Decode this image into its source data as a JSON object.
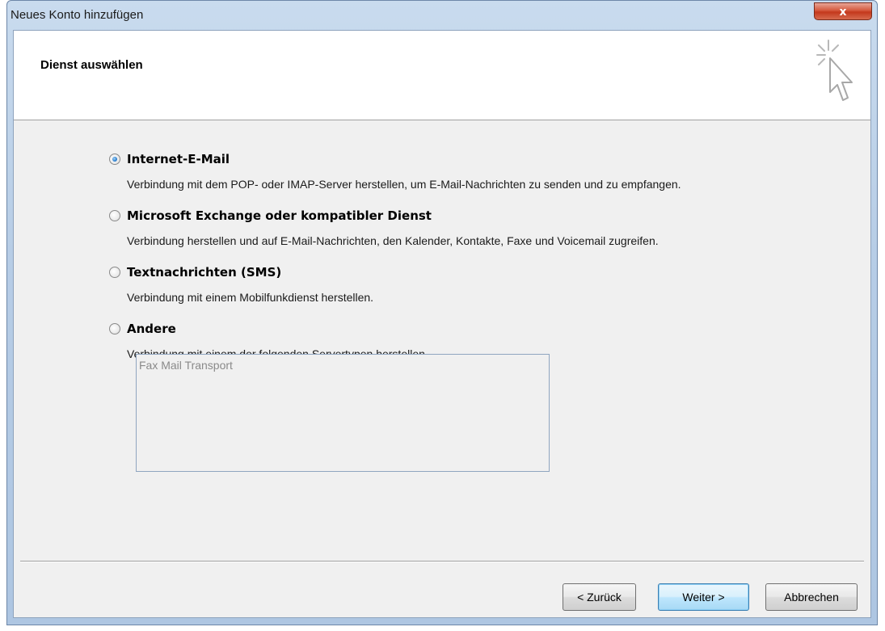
{
  "window": {
    "title": "Neues Konto hinzufügen",
    "close_glyph": "x"
  },
  "header": {
    "title": "Dienst auswählen",
    "icon": "cursor-sparkle-icon"
  },
  "options": [
    {
      "label": "Internet-E-Mail",
      "description": "Verbindung mit dem POP- oder IMAP-Server herstellen, um E-Mail-Nachrichten zu senden und zu empfangen.",
      "selected": true
    },
    {
      "label": "Microsoft Exchange oder kompatibler Dienst",
      "description": "Verbindung herstellen und auf E-Mail-Nachrichten, den Kalender, Kontakte, Faxe und Voicemail zugreifen.",
      "selected": false
    },
    {
      "label": "Textnachrichten (SMS)",
      "description": "Verbindung mit einem Mobilfunkdienst herstellen.",
      "selected": false
    },
    {
      "label": "Andere",
      "description": "Verbindung mit einem der folgenden Servertypen herstellen.",
      "selected": false
    }
  ],
  "server_types": {
    "items": [
      "Fax Mail Transport"
    ]
  },
  "buttons": {
    "back": "< Zurück",
    "next": "Weiter >",
    "cancel": "Abbrechen"
  },
  "colors": {
    "title_bar": "#b7cde6",
    "close_button": "#c4381c",
    "primary_button": "#bee6fd",
    "radio_selected": "#2a7fd0"
  }
}
